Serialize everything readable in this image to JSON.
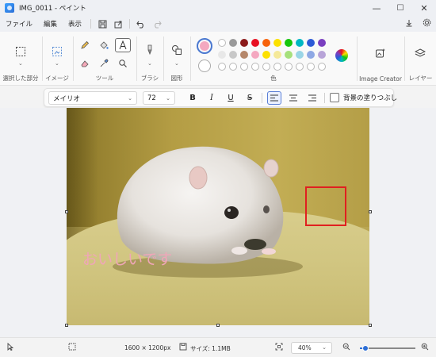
{
  "window": {
    "title": "IMG_0011 - ペイント",
    "minimize": "—",
    "maximize": "☐",
    "close": "✕"
  },
  "menu": {
    "items": [
      "ファイル",
      "編集",
      "表示"
    ],
    "save_icon": "💾",
    "share_icon": "⇪",
    "undo_icon": "↶",
    "redo_icon": "↷",
    "account_icon": "⍚",
    "settings_icon": "⚙"
  },
  "ribbon": {
    "groups": {
      "selection": "選択した部分",
      "image": "イメージ",
      "tools": "ツール",
      "brushes": "ブラシ",
      "shapes": "図形",
      "colors": "色",
      "image_creator": "Image Creator",
      "layers": "レイヤー"
    },
    "color_rows": [
      [
        "#ffffff",
        "#9a9a9a",
        "#8b1a1a",
        "#e81123",
        "#f7630c",
        "#fce100",
        "#16c60c",
        "#00b7c3",
        "#2d5ad6",
        "#7a3fc0"
      ],
      [
        "#e8e8e8",
        "#c8c8c8",
        "#b5876a",
        "#f4a8c0",
        "#fce100",
        "#f5e99a",
        "#a6e07c",
        "#9ad5e6",
        "#8ea8e4",
        "#b8a4d8"
      ],
      [
        "",
        "",
        "",
        "",
        "",
        "",
        "",
        "",
        "",
        ""
      ]
    ],
    "primary_color": "#f4a8c0",
    "secondary_color": "#ffffff"
  },
  "textbar": {
    "font": "メイリオ",
    "size": "72",
    "bold": "B",
    "italic": "I",
    "underline": "U",
    "strike": "S",
    "fill_label": "背景の塗りつぶし"
  },
  "canvas": {
    "caption": "おいしいです"
  },
  "status": {
    "dimensions": "1600 × 1200px",
    "size": "サイズ: 1.1MB",
    "zoom": "40%",
    "zoom_level": 0.1
  }
}
